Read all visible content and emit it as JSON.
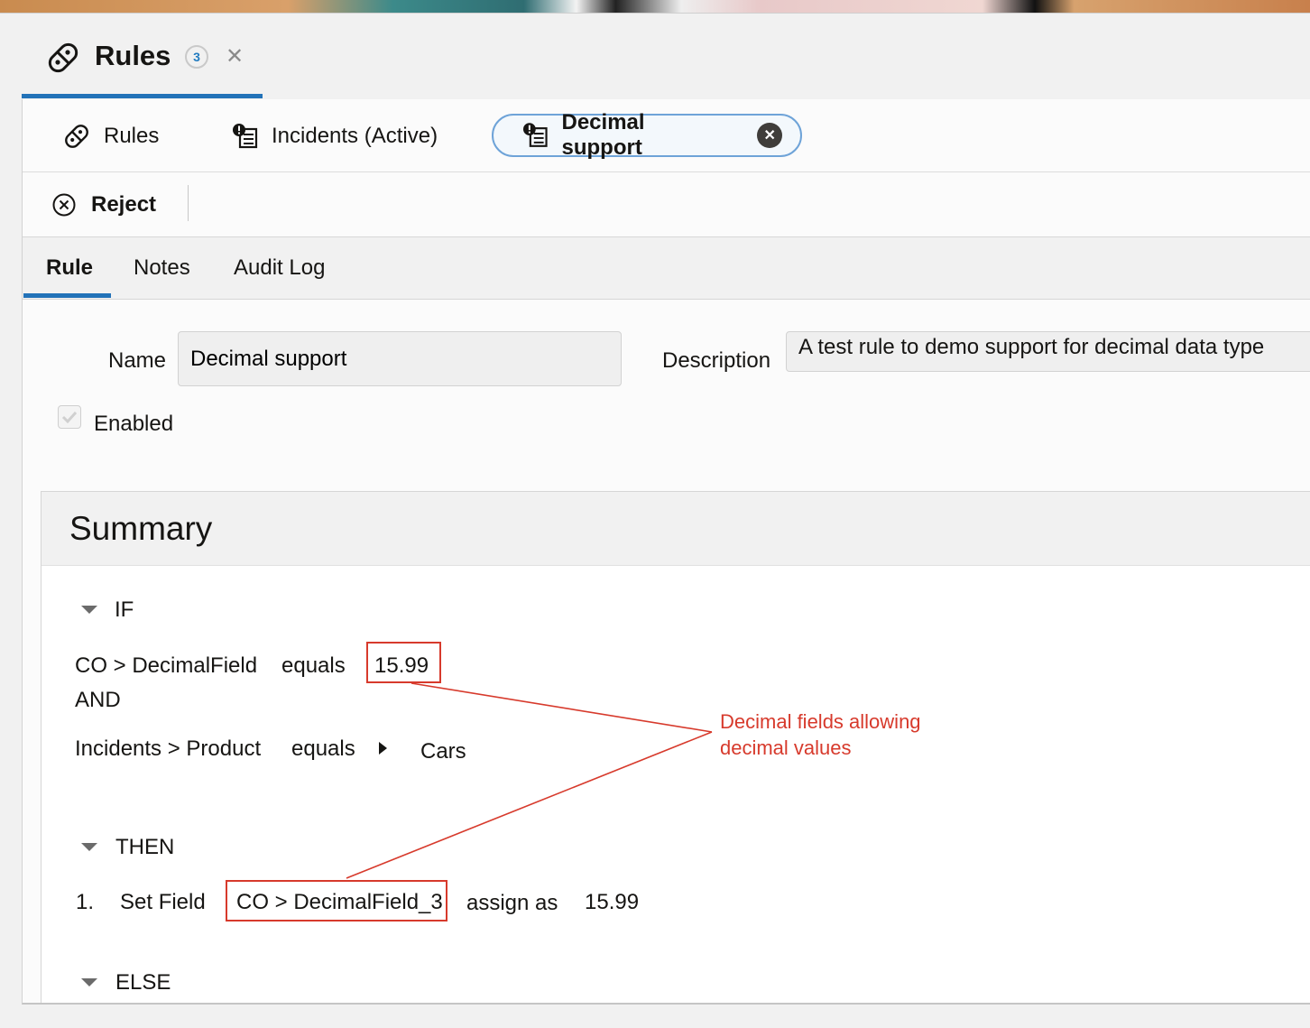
{
  "header": {
    "title": "Rules",
    "count": "3",
    "close_glyph": "✕"
  },
  "tabs": [
    {
      "label": "Rules"
    },
    {
      "label": "Incidents (Active)"
    },
    {
      "label": "Decimal support",
      "close_glyph": "✕"
    }
  ],
  "toolbar": {
    "reject_label": "Reject"
  },
  "subtabs": [
    {
      "label": "Rule"
    },
    {
      "label": "Notes"
    },
    {
      "label": "Audit Log"
    }
  ],
  "form": {
    "name_label": "Name",
    "name_value": "Decimal support",
    "description_label": "Description",
    "description_value": "A test rule to demo support for decimal data type",
    "enabled_label": "Enabled"
  },
  "summary": {
    "title": "Summary",
    "if_label": "IF",
    "cond1": {
      "field": "CO > DecimalField",
      "operator": "equals",
      "value": "15.99"
    },
    "and_label": "AND",
    "cond2": {
      "field": "Incidents > Product",
      "operator": "equals",
      "value": "Cars"
    },
    "then_label": "THEN",
    "action1": {
      "index": "1.",
      "action": "Set Field",
      "field": "CO > DecimalField_3",
      "verb": "assign as",
      "value": "15.99"
    },
    "else_label": "ELSE"
  },
  "annotation": {
    "line1": "Decimal fields allowing",
    "line2": "decimal values"
  },
  "colors": {
    "accent": "#2272b8",
    "annotation": "#d73a2c",
    "active_tab_border": "#6ea3d8"
  }
}
